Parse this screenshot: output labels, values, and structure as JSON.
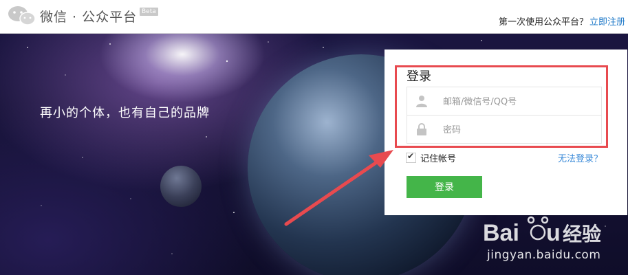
{
  "header": {
    "brand": "微信 · 公众平台",
    "beta": "Beta",
    "first_time_text": "第一次使用公众平台？",
    "register_link": "立即注册"
  },
  "hero": {
    "tagline": "再小的个体，也有自己的品牌"
  },
  "login": {
    "title": "登录",
    "username_placeholder": "邮箱/微信号/QQ号",
    "password_placeholder": "密码",
    "remember_label": "记住帐号",
    "remember_checked": true,
    "cant_login": "无法登录？",
    "submit_label": "登录"
  },
  "watermark": {
    "logo_text": "Baidu经验",
    "url": "jingyan.baidu.com"
  },
  "colors": {
    "primary_green": "#44b549",
    "link_blue": "#1e78c8",
    "annotation_red": "#e84a4f"
  }
}
